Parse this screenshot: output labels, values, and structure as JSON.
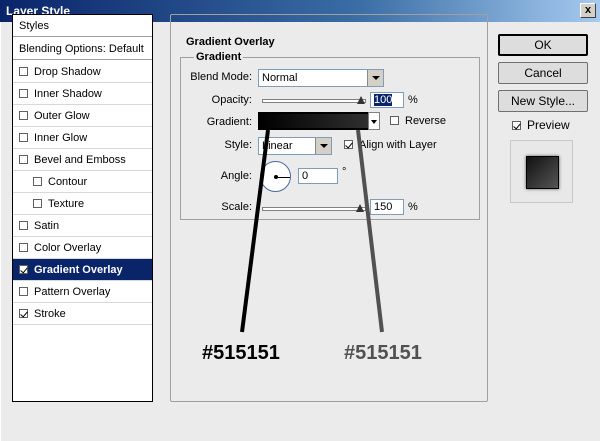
{
  "window": {
    "title": "Layer Style",
    "close_label": "x"
  },
  "left_panel": {
    "header": "Styles",
    "blending": "Blending Options: Default",
    "items": [
      {
        "label": "Drop Shadow",
        "checked": false
      },
      {
        "label": "Inner Shadow",
        "checked": false
      },
      {
        "label": "Outer Glow",
        "checked": false
      },
      {
        "label": "Inner Glow",
        "checked": false
      },
      {
        "label": "Bevel and Emboss",
        "checked": false
      },
      {
        "label": "Contour",
        "checked": false
      },
      {
        "label": "Texture",
        "checked": false
      },
      {
        "label": "Satin",
        "checked": false
      },
      {
        "label": "Color Overlay",
        "checked": false
      },
      {
        "label": "Gradient Overlay",
        "checked": true
      },
      {
        "label": "Pattern Overlay",
        "checked": false
      },
      {
        "label": "Stroke",
        "checked": true
      }
    ]
  },
  "main": {
    "section_title": "Gradient Overlay",
    "group_title": "Gradient",
    "blend_mode_label": "Blend Mode:",
    "blend_mode_value": "Normal",
    "opacity_label": "Opacity:",
    "opacity_value": "100",
    "opacity_unit": "%",
    "gradient_label": "Gradient:",
    "reverse_label": "Reverse",
    "style_label": "Style:",
    "style_value": "Linear",
    "align_label": "Align with Layer",
    "angle_label": "Angle:",
    "angle_value": "0",
    "angle_unit": "°",
    "scale_label": "Scale:",
    "scale_value": "150",
    "scale_unit": "%"
  },
  "buttons": {
    "ok": "OK",
    "cancel": "Cancel",
    "new_style": "New Style...",
    "preview": "Preview"
  },
  "annotations": {
    "left": "#515151",
    "right": "#515151",
    "left_color": "#000000",
    "right_color": "#515151"
  }
}
